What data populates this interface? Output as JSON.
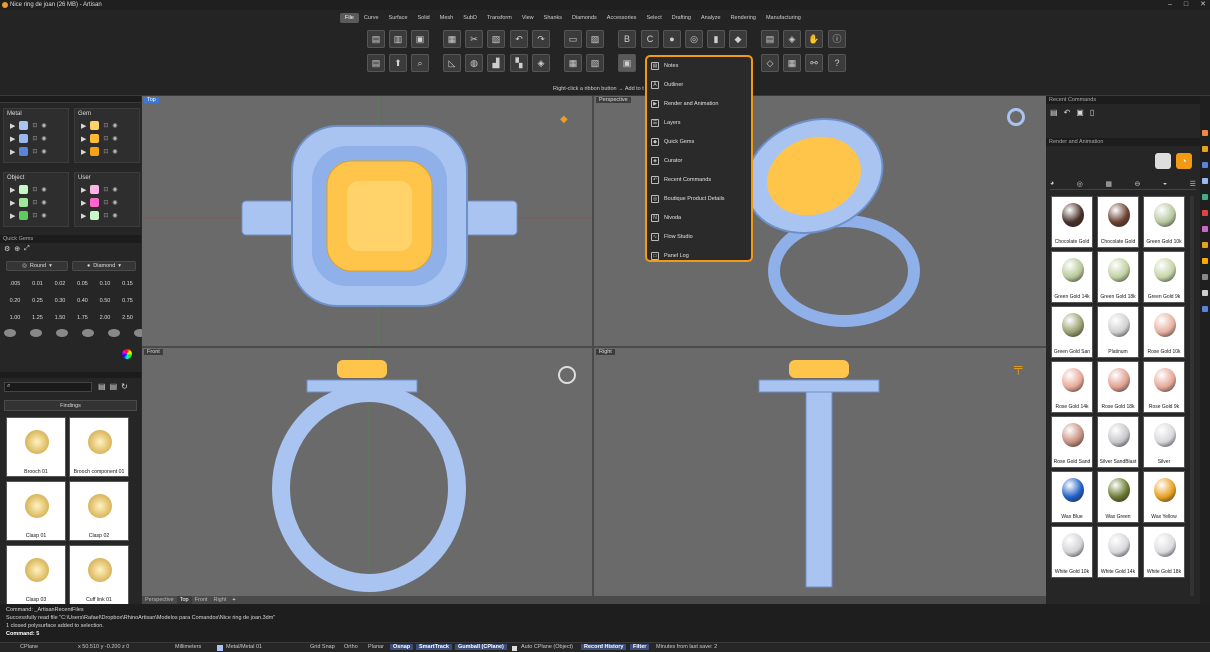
{
  "window": {
    "title": "Nice ring de joan (26 MB) - Artisan"
  },
  "menus": [
    "File",
    "Curve",
    "Surface",
    "Solid",
    "Mesh",
    "SubD",
    "Transform",
    "View",
    "Shanks",
    "Diamonds",
    "Accessories",
    "Select",
    "Drafting",
    "Analyze",
    "Rendering",
    "Manufacturing"
  ],
  "hint": "Right-click a ribbon button → Add to t",
  "left": {
    "groups": [
      {
        "title": "Metal",
        "colors": [
          "#a9c4f0",
          "#9ab8f0",
          "#5b84d8"
        ]
      },
      {
        "title": "Gem",
        "colors": [
          "#ffd36a",
          "#ffbb33",
          "#f5a314"
        ]
      },
      {
        "title": "Object",
        "colors": [
          "#c9f7c9",
          "#9ee89e",
          "#5fc95f"
        ]
      },
      {
        "title": "User",
        "colors": [
          "#ffb3e6",
          "#ff66cc",
          "#c9f7c9"
        ]
      }
    ],
    "quick_gems": {
      "title": "Quick Gems",
      "shape": "Round",
      "cut": "Diamond",
      "sizes": [
        ".005",
        "0.01",
        "0.02",
        "0.05",
        "0.10",
        "0.15",
        "0.20",
        "0.25",
        "0.30",
        "0.40",
        "0.50",
        "0.75",
        "1.00",
        "1.25",
        "1.50",
        "1.75",
        "2.00",
        "2.50"
      ]
    },
    "findings": {
      "title": "Findings",
      "items": [
        "Brooch 01",
        "Brooch component 01",
        "Clasp 01",
        "Clasp 02",
        "Clasp 03",
        "Cuff link 01"
      ]
    }
  },
  "viewports": {
    "top": "Top",
    "perspective": "Perspective",
    "front": "Front",
    "right": "Right",
    "tabs": [
      "Perspective",
      "Top",
      "Front",
      "Right"
    ]
  },
  "popup": [
    "Notes",
    "Outliner",
    "Render and Animation",
    "Layers",
    "Quick Gems",
    "Curator",
    "Recent Commands",
    "Boutique Product Details",
    "Nivoda",
    "Flow Studio",
    "Panel Log"
  ],
  "right": {
    "recent_title": "Recent Commands",
    "render_title": "Render and Animation",
    "materials": [
      {
        "name": "Chocolate Gold",
        "color": "#4a3028"
      },
      {
        "name": "Chocolate Gold",
        "color": "#6a4030"
      },
      {
        "name": "Green Gold 10k",
        "color": "#b8c8a0"
      },
      {
        "name": "Green Gold 14k",
        "color": "#b8c89a"
      },
      {
        "name": "Green Gold 18k",
        "color": "#c0d0a0"
      },
      {
        "name": "Green Gold 9k",
        "color": "#c4d4a6"
      },
      {
        "name": "Green Gold San",
        "color": "#9aa070"
      },
      {
        "name": "Platinum",
        "color": "#d0d0d0"
      },
      {
        "name": "Rose Gold 10k",
        "color": "#e8b0a0"
      },
      {
        "name": "Rose Gold 14k",
        "color": "#e8a898"
      },
      {
        "name": "Rose Gold 18k",
        "color": "#e0a090"
      },
      {
        "name": "Rose Gold 9k",
        "color": "#e6a898"
      },
      {
        "name": "Rose Gold Sand",
        "color": "#c89080"
      },
      {
        "name": "Silver SandBlast",
        "color": "#c8c8cc"
      },
      {
        "name": "Silver",
        "color": "#d8d8dc"
      },
      {
        "name": "Wax Blue",
        "color": "#1f5fc8"
      },
      {
        "name": "Wax Green",
        "color": "#6a7a30"
      },
      {
        "name": "Wax Yellow",
        "color": "#e8a020"
      },
      {
        "name": "White Gold 10k",
        "color": "#d4d4d8"
      },
      {
        "name": "White Gold 14k",
        "color": "#d8d8dc"
      },
      {
        "name": "White Gold 18k",
        "color": "#dcdce0"
      }
    ]
  },
  "command": {
    "lines": [
      "Command: _ArtisanRecentFiles",
      "Successfully read file \"C:\\Users\\Rafael\\Dropbox\\RhinoArtisan\\Modelos para Comandos\\Nice ring de joan.3dm\"",
      "1 closed polysurface added to selection."
    ],
    "prompt": "Command: 5"
  },
  "status": {
    "cplane": "CPlane",
    "coords": "x 50.510  y -0.200  z 0",
    "units": "Millimeters",
    "layer": "Metal/Metal 01",
    "grid_snap": "Grid Snap",
    "ortho": "Ortho",
    "planar": "Planar",
    "osnap": "Osnap",
    "smarttrack": "SmartTrack",
    "gumball": "Gumball (CPlane)",
    "auto_cplane": "Auto CPlane (Object)",
    "record": "Record History",
    "filter": "Filter",
    "save": "Minutes from last save: 2"
  }
}
